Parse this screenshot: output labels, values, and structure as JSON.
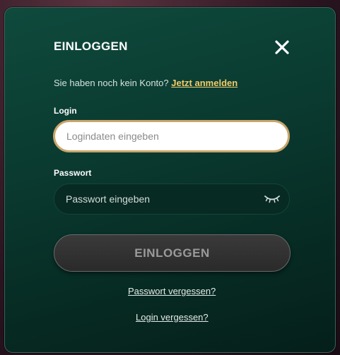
{
  "modal": {
    "title": "EINLOGGEN",
    "close_icon": "close-icon",
    "signup_prompt": "Sie haben noch kein Konto?",
    "signup_link": "Jetzt anmelden",
    "login": {
      "label": "Login",
      "placeholder": "Logindaten eingeben",
      "value": ""
    },
    "password": {
      "label": "Passwort",
      "placeholder": "Passwort eingeben",
      "value": "",
      "toggle_icon": "eye-closed-icon"
    },
    "submit_label": "EINLOGGEN",
    "forgot_password": "Passwort vergessen?",
    "forgot_login": "Login vergessen?"
  },
  "colors": {
    "accent_link": "#f2cc6a",
    "input_focus_border": "#c9a56a",
    "modal_bg": "#0a3a30"
  }
}
